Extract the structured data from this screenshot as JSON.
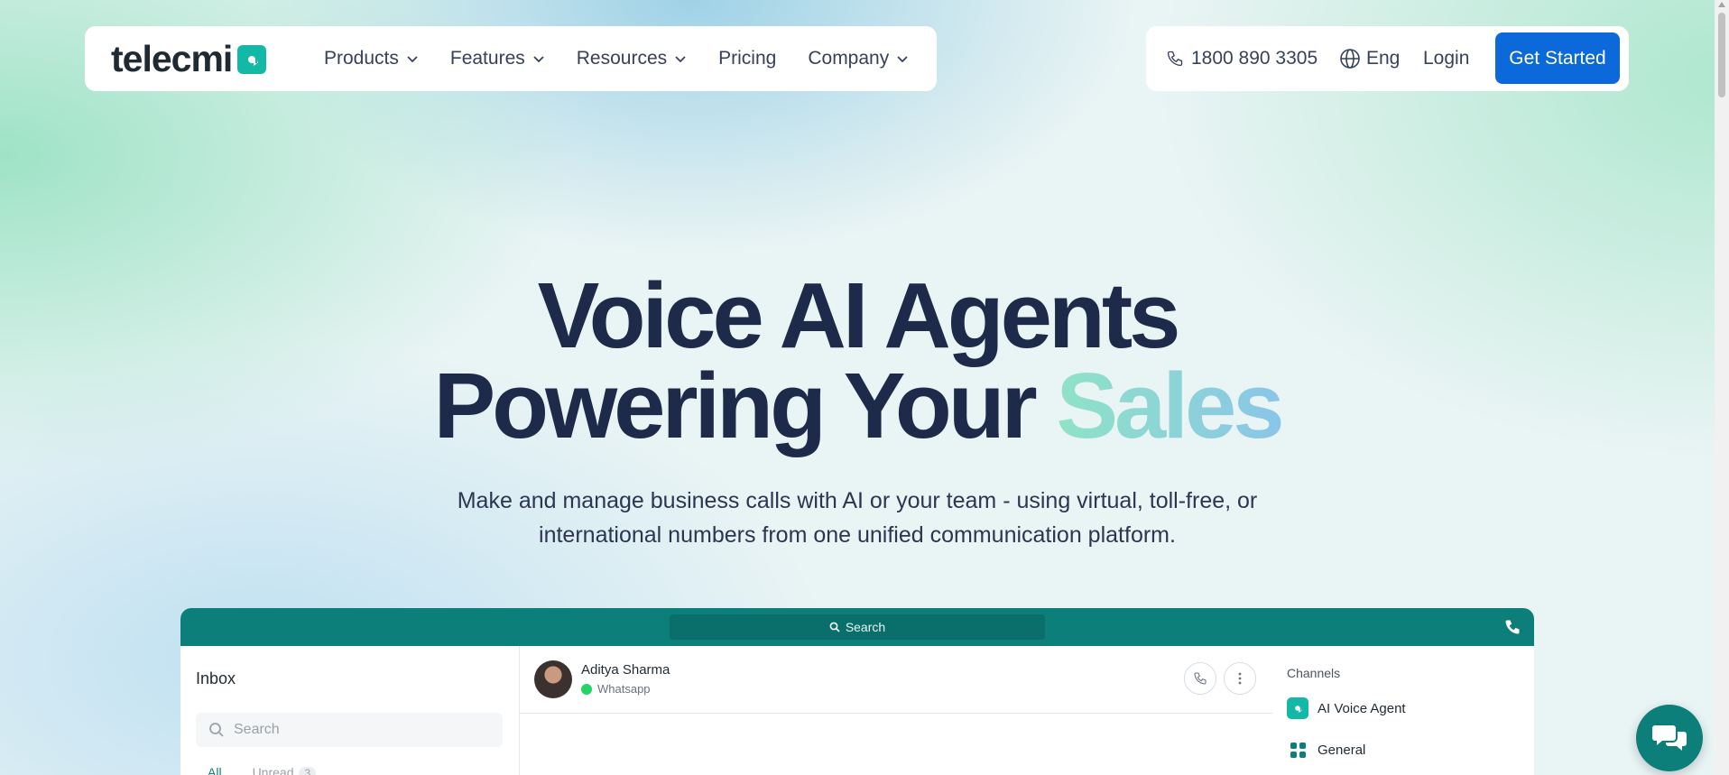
{
  "brand": {
    "name": "telecmi",
    "accent": "#14b8a6",
    "primary": "#0b69d9",
    "app_color": "#0d7f7a"
  },
  "nav": {
    "menu": [
      {
        "label": "Products",
        "dropdown": true
      },
      {
        "label": "Features",
        "dropdown": true
      },
      {
        "label": "Resources",
        "dropdown": true
      },
      {
        "label": "Pricing",
        "dropdown": false
      },
      {
        "label": "Company",
        "dropdown": true
      }
    ],
    "phone": "1800 890 3305",
    "language": "Eng",
    "login": "Login",
    "cta": "Get Started"
  },
  "hero": {
    "line1": "Voice AI Agents",
    "line2_prefix": "Powering Your ",
    "line2_accent": "Sales",
    "subtitle": "Make and manage business calls with AI or your team - using virtual, toll-free, or international numbers from one unified communication platform."
  },
  "app_preview": {
    "search_label": "Search",
    "inbox": {
      "title": "Inbox",
      "search_placeholder": "Search",
      "tabs": [
        {
          "label": "All"
        },
        {
          "label": "Unread",
          "count": "3"
        }
      ]
    },
    "conversation": {
      "name": "Aditya Sharma",
      "channel": "Whatsapp"
    },
    "channels": {
      "title": "Channels",
      "items": [
        {
          "label": "AI Voice Agent",
          "icon": "ai-agent-icon"
        },
        {
          "label": "General",
          "icon": "grid-icon"
        }
      ]
    }
  }
}
